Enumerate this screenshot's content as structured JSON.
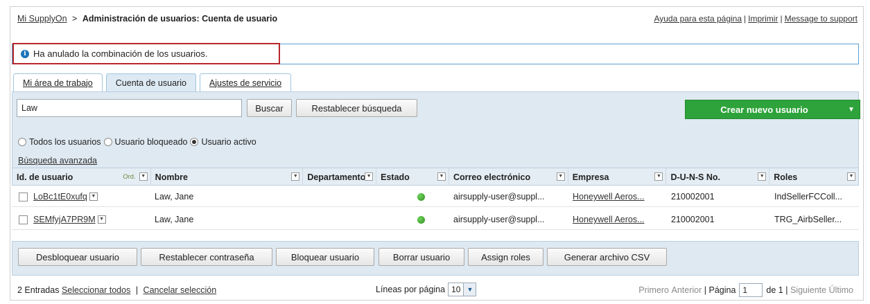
{
  "header": {
    "breadcrumb_link": "Mi SupplyOn",
    "breadcrumb_sep": ">",
    "breadcrumb_current": "Administración de usuarios: Cuenta de usuario",
    "links": [
      "Ayuda para esta página",
      "Imprimir",
      "Message to support"
    ]
  },
  "message": {
    "icon": "info-icon",
    "text": "Ha anulado la combinación de los usuarios."
  },
  "tabs": [
    {
      "label": "Mi área de trabajo",
      "active": false
    },
    {
      "label": "Cuenta de usuario",
      "active": true
    },
    {
      "label": "Ajustes de servicio",
      "active": false
    }
  ],
  "search": {
    "value": "Law",
    "search_button": "Buscar",
    "reset_button": "Restablecer búsqueda",
    "create_button": "Crear nuevo usuario",
    "radios": [
      {
        "label": "Todos los usuarios",
        "checked": false
      },
      {
        "label": "Usuario bloqueado",
        "checked": false
      },
      {
        "label": "Usuario activo",
        "checked": true
      }
    ],
    "advanced_link": "Búsqueda avanzada"
  },
  "table": {
    "columns": [
      "Id. de usuario",
      "Nombre",
      "Departamento",
      "Estado",
      "Correo electrónico",
      "Empresa",
      "D-U-N-S No.",
      "Roles"
    ],
    "sort_label": "Ord.",
    "rows": [
      {
        "id": "LoBc1tE0xufq",
        "name": "Law, Jane",
        "department": "",
        "status": "active",
        "email": "airsupply-user@suppl...",
        "company": "Honeywell Aeros...",
        "duns": "210002001",
        "roles": "IndSellerFCColl..."
      },
      {
        "id": "SEMfyjA7PR9M",
        "name": "Law, Jane",
        "department": "",
        "status": "active",
        "email": "airsupply-user@suppl...",
        "company": "Honeywell Aeros...",
        "duns": "210002001",
        "roles": "TRG_AirbSeller..."
      }
    ]
  },
  "actions": [
    "Desbloquear usuario",
    "Restablecer contraseña",
    "Bloquear usuario",
    "Borrar usuario",
    "Assign roles",
    "Generar archivo CSV"
  ],
  "footer": {
    "count_text": "2 Entradas",
    "select_all": "Seleccionar todos",
    "sep": "|",
    "cancel_selection": "Cancelar selección",
    "lines_label": "Líneas por página",
    "lines_value": "10",
    "first": "Primero",
    "previous": "Anterior",
    "page_label": "Página",
    "page_value": "1",
    "of_text": "de 1",
    "next": "Siguiente",
    "last": "Último"
  },
  "colors": {
    "accent_blue": "#1c73b8",
    "create_green": "#2fa33b",
    "alert_red": "#b8262a",
    "status_green": "#2e8f1f"
  }
}
